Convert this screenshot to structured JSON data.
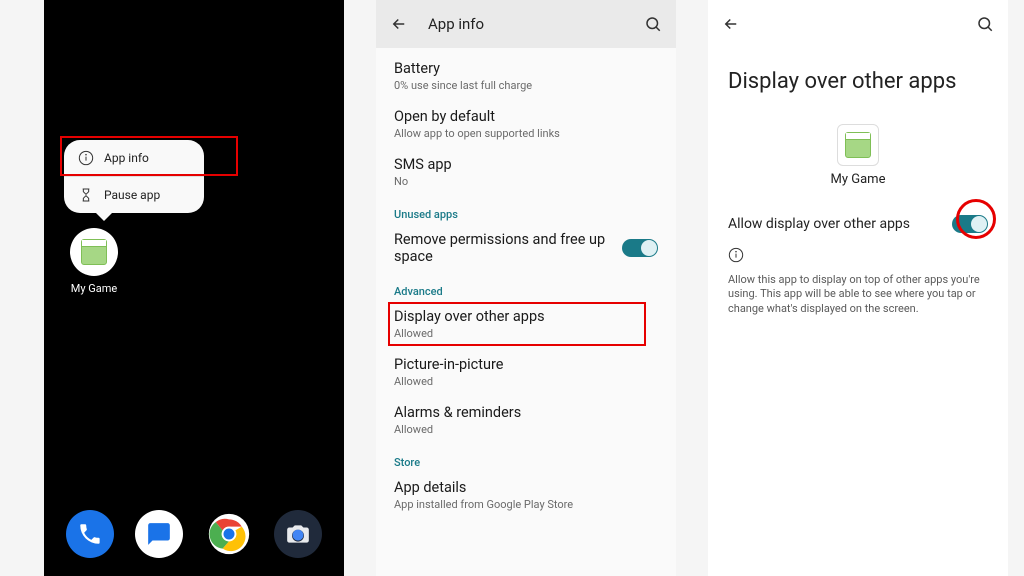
{
  "screen1": {
    "popup": {
      "app_info": "App info",
      "pause_app": "Pause app"
    },
    "app_name": "My Game"
  },
  "screen2": {
    "title": "App info",
    "rows": {
      "battery": {
        "title": "Battery",
        "sub": "0% use since last full charge"
      },
      "open_default": {
        "title": "Open by default",
        "sub": "Allow app to open supported links"
      },
      "sms": {
        "title": "SMS app",
        "sub": "No"
      },
      "remove_perms": {
        "title": "Remove permissions and free up space"
      },
      "display_over": {
        "title": "Display over other apps",
        "sub": "Allowed"
      },
      "pip": {
        "title": "Picture-in-picture",
        "sub": "Allowed"
      },
      "alarms": {
        "title": "Alarms & reminders",
        "sub": "Allowed"
      },
      "app_details": {
        "title": "App details",
        "sub": "App installed from Google Play Store"
      }
    },
    "headers": {
      "unused": "Unused apps",
      "advanced": "Advanced",
      "store": "Store"
    }
  },
  "screen3": {
    "title": "Display over other apps",
    "app_name": "My Game",
    "toggle_label": "Allow display over other apps",
    "description": "Allow this app to display on top of other apps you're using. This app will be able to see where you tap or change what's displayed on the screen."
  }
}
